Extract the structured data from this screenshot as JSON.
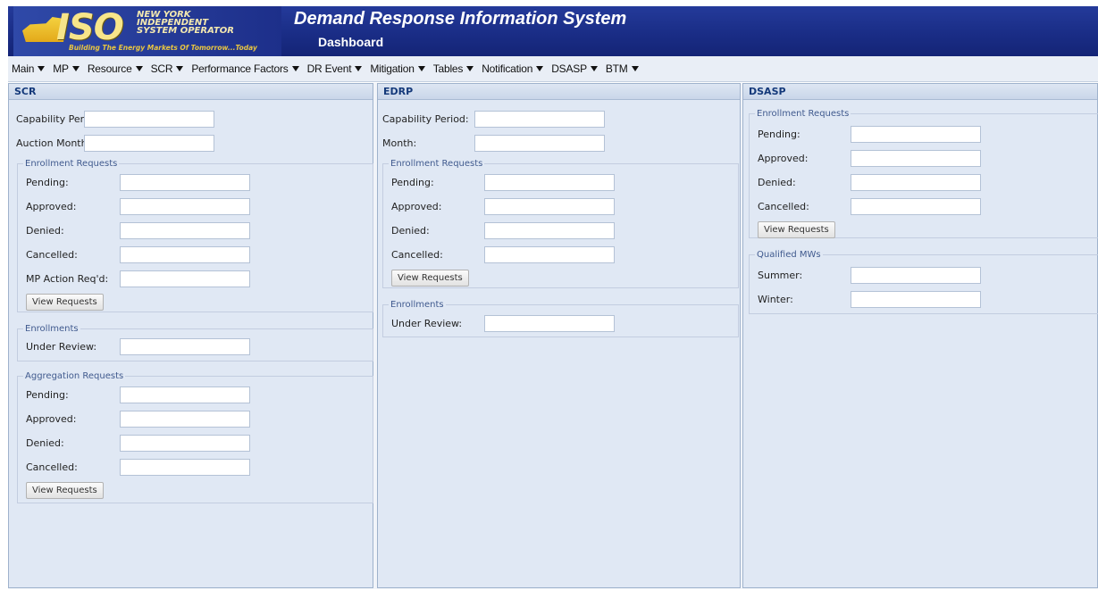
{
  "header": {
    "logo_text": "ISO",
    "logo_name_lines": [
      "NEW YORK",
      "INDEPENDENT",
      "SYSTEM OPERATOR"
    ],
    "logo_tagline": "Building The Energy Markets Of Tomorrow...Today",
    "app_title": "Demand Response Information System",
    "page_title": "Dashboard"
  },
  "menu": [
    {
      "label": "Main"
    },
    {
      "label": "MP"
    },
    {
      "label": "Resource"
    },
    {
      "label": "SCR"
    },
    {
      "label": "Performance Factors"
    },
    {
      "label": "DR Event"
    },
    {
      "label": "Mitigation"
    },
    {
      "label": "Tables"
    },
    {
      "label": "Notification"
    },
    {
      "label": "DSASP"
    },
    {
      "label": "BTM"
    }
  ],
  "scr": {
    "title": "SCR",
    "capability_period_label": "Capability Period:",
    "auction_month_label": "Auction Month:",
    "enrollment_requests": {
      "legend": "Enrollment Requests",
      "pending_label": "Pending:",
      "approved_label": "Approved:",
      "denied_label": "Denied:",
      "cancelled_label": "Cancelled:",
      "mp_action_label": "MP Action Req'd:",
      "view_button": "View Requests"
    },
    "enrollments": {
      "legend": "Enrollments",
      "under_review_label": "Under Review:"
    },
    "aggregation_requests": {
      "legend": "Aggregation Requests",
      "pending_label": "Pending:",
      "approved_label": "Approved:",
      "denied_label": "Denied:",
      "cancelled_label": "Cancelled:",
      "view_button": "View Requests"
    }
  },
  "edrp": {
    "title": "EDRP",
    "capability_period_label": "Capability Period:",
    "month_label": "Month:",
    "enrollment_requests": {
      "legend": "Enrollment Requests",
      "pending_label": "Pending:",
      "approved_label": "Approved:",
      "denied_label": "Denied:",
      "cancelled_label": "Cancelled:",
      "view_button": "View Requests"
    },
    "enrollments": {
      "legend": "Enrollments",
      "under_review_label": "Under Review:"
    }
  },
  "dsasp": {
    "title": "DSASP",
    "enrollment_requests": {
      "legend": "Enrollment Requests",
      "pending_label": "Pending:",
      "approved_label": "Approved:",
      "denied_label": "Denied:",
      "cancelled_label": "Cancelled:",
      "view_button": "View Requests"
    },
    "qualified_mws": {
      "legend": "Qualified MWs",
      "summer_label": "Summer:",
      "winter_label": "Winter:"
    }
  }
}
